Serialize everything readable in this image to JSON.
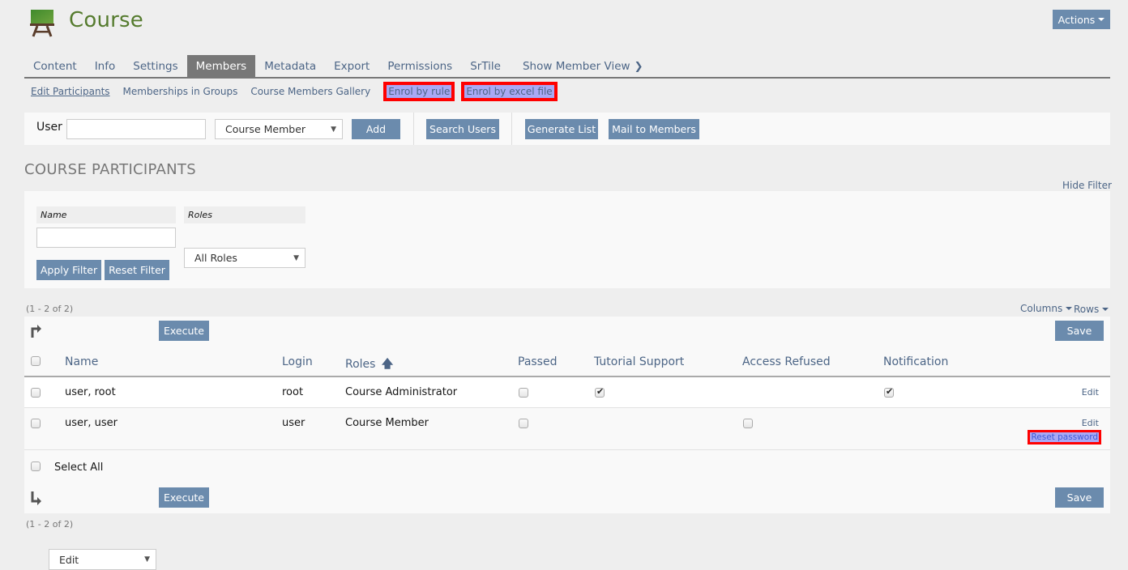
{
  "header": {
    "title": "Course",
    "icon": "course-easel-icon",
    "actions_label": "Actions"
  },
  "tabs": [
    {
      "label": "Content",
      "active": false
    },
    {
      "label": "Info",
      "active": false
    },
    {
      "label": "Settings",
      "active": false
    },
    {
      "label": "Members",
      "active": true
    },
    {
      "label": "Metadata",
      "active": false
    },
    {
      "label": "Export",
      "active": false
    },
    {
      "label": "Permissions",
      "active": false
    },
    {
      "label": "SrTile",
      "active": false
    },
    {
      "label": "Show Member View",
      "active": false,
      "icon": "chevron-right-icon"
    }
  ],
  "subtabs": [
    {
      "label": "Edit Participants",
      "current": true
    },
    {
      "label": "Memberships in Groups"
    },
    {
      "label": "Course Members Gallery"
    },
    {
      "label": "Enrol by rule",
      "highlighted": true
    },
    {
      "label": "Enrol by excel file",
      "highlighted": true
    }
  ],
  "toolbar": {
    "user_label": "User",
    "user_value": "",
    "role_select": "Course Member",
    "add_label": "Add",
    "search_users_label": "Search Users",
    "generate_list_label": "Generate List",
    "mail_members_label": "Mail to Members"
  },
  "section_title": "COURSE PARTICIPANTS",
  "filter": {
    "hide_label": "Hide Filter",
    "name_label": "Name",
    "name_value": "",
    "roles_label": "Roles",
    "roles_value": "All Roles",
    "apply_label": "Apply Filter",
    "reset_label": "Reset Filter"
  },
  "table": {
    "count_text": "(1 - 2 of 2)",
    "columns_label": "Columns",
    "rows_label": "Rows",
    "command_select": "Edit",
    "execute_label": "Execute",
    "save_label": "Save",
    "headers": {
      "name": "Name",
      "login": "Login",
      "roles": "Roles",
      "passed": "Passed",
      "tutorial_support": "Tutorial Support",
      "access_refused": "Access Refused",
      "notification": "Notification"
    },
    "sort_icon": "arrow-up-icon",
    "rows": [
      {
        "name": "user, root",
        "login": "root",
        "roles": "Course Administrator",
        "passed": false,
        "tutorial_support": true,
        "access_refused": null,
        "notification": true,
        "edit_label": "Edit"
      },
      {
        "name": "user, user",
        "login": "user",
        "roles": "Course Member",
        "passed": false,
        "tutorial_support": null,
        "access_refused": false,
        "notification": null,
        "edit_label": "Edit",
        "reset_password_label": "Reset password"
      }
    ],
    "select_all_label": "Select All"
  },
  "colors": {
    "accent_button": "#6b8bad",
    "title_green": "#557b2e",
    "link": "#4c6586",
    "highlight_outline": "#ff0000",
    "highlight_fill": "#a9a9f5"
  }
}
